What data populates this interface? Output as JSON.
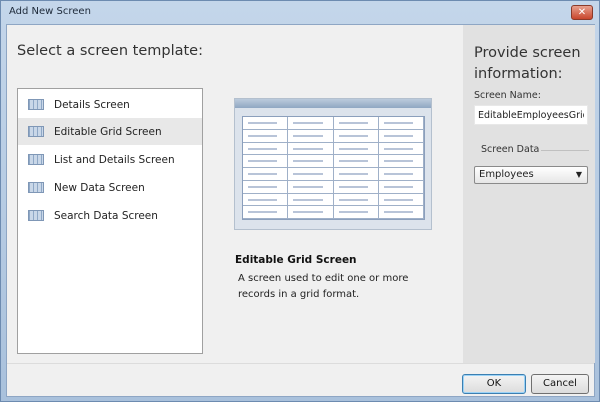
{
  "window": {
    "title": "Add New Screen",
    "close_icon": "close-icon"
  },
  "templates": {
    "heading": "Select a screen template:",
    "items": [
      {
        "label": "Details Screen",
        "icon": "details-screen-icon"
      },
      {
        "label": "Editable Grid Screen",
        "icon": "grid-screen-icon",
        "selected": true
      },
      {
        "label": "List and Details Screen",
        "icon": "list-details-screen-icon"
      },
      {
        "label": "New Data Screen",
        "icon": "new-data-screen-icon"
      },
      {
        "label": "Search Data Screen",
        "icon": "search-data-screen-icon"
      }
    ]
  },
  "preview": {
    "title": "Editable Grid Screen",
    "description": "A screen used to edit one or more records in a grid format."
  },
  "info": {
    "heading": "Provide screen information:",
    "screen_name_label": "Screen Name:",
    "screen_name_value": "EditableEmployeesGrid",
    "screen_data_label": "Screen Data",
    "screen_data_value": "Employees"
  },
  "footer": {
    "ok": "OK",
    "cancel": "Cancel"
  }
}
